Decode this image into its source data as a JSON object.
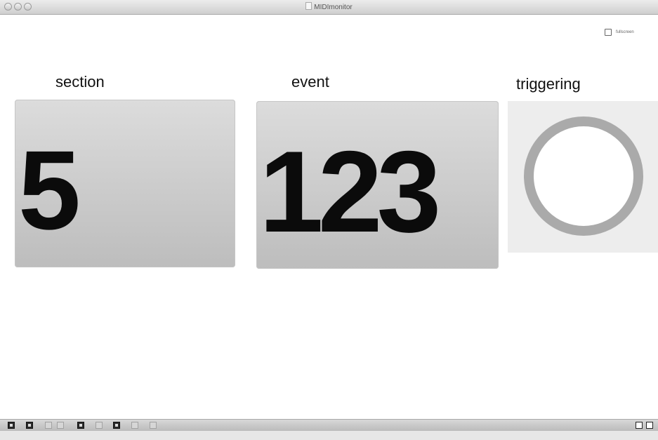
{
  "window": {
    "title": "MIDImonitor"
  },
  "fullscreen": {
    "label": "fullscreen",
    "checked": false
  },
  "panels": {
    "section": {
      "label": "section",
      "value": "5"
    },
    "event": {
      "label": "event",
      "value": "123"
    },
    "triggering": {
      "label": "triggering",
      "state": "off"
    }
  },
  "colors": {
    "panel_top": "#dcdcdc",
    "panel_bottom": "#bdbdbd",
    "ring": "#aaaaaa",
    "number": "#0b0b0b"
  },
  "toolbar": {
    "icons": [
      "lock-icon",
      "expand-icon",
      "connect-icon",
      "inspector-icon",
      "presentation-icon",
      "grid-icon",
      "edit-icon",
      "palette-icon",
      "locked-icon"
    ],
    "right_icons": [
      "view-left-icon",
      "view-right-icon"
    ]
  }
}
